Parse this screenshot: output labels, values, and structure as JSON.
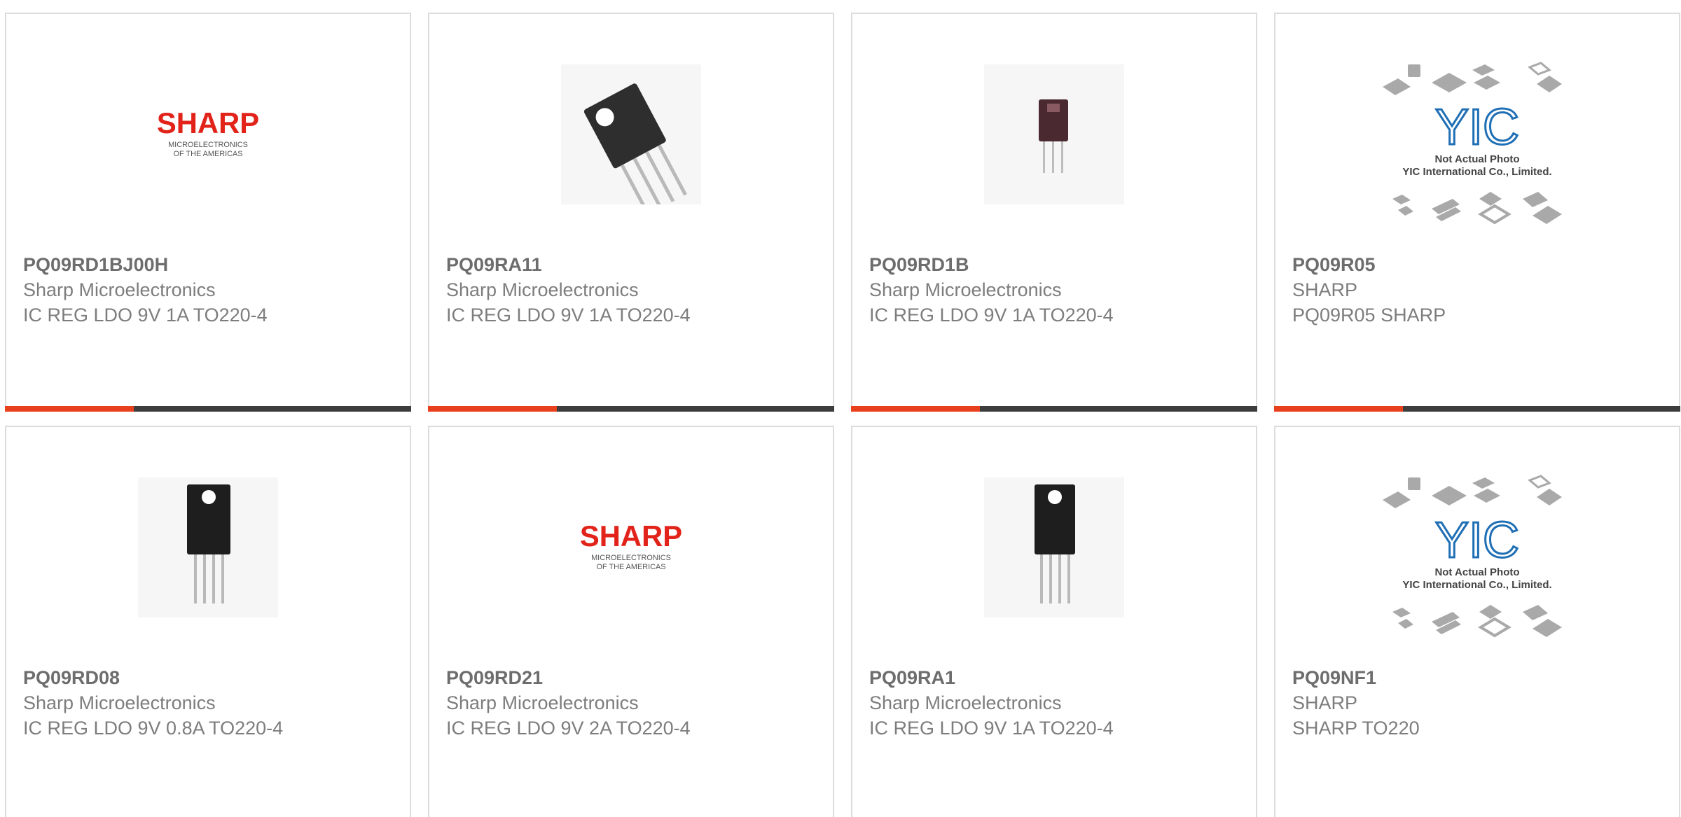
{
  "products": [
    {
      "part": "PQ09RD1BJ00H",
      "manufacturer": "Sharp Microelectronics",
      "description": "IC REG LDO 9V 1A TO220-4",
      "image": "sharp-logo"
    },
    {
      "part": "PQ09RA11",
      "manufacturer": "Sharp Microelectronics",
      "description": "IC REG LDO 9V 1A TO220-4",
      "image": "to220-angled-photo"
    },
    {
      "part": "PQ09RD1B",
      "manufacturer": "Sharp Microelectronics",
      "description": "IC REG LDO 9V 1A TO220-4",
      "image": "to220-small-photo"
    },
    {
      "part": "PQ09R05",
      "manufacturer": "SHARP",
      "description": "PQ09R05 SHARP",
      "image": "yic-placeholder"
    },
    {
      "part": "PQ09RD08",
      "manufacturer": "Sharp Microelectronics",
      "description": "IC REG LDO 9V 0.8A TO220-4",
      "image": "to220-front-photo"
    },
    {
      "part": "PQ09RD21",
      "manufacturer": "Sharp Microelectronics",
      "description": "IC REG LDO 9V 2A TO220-4",
      "image": "sharp-logo"
    },
    {
      "part": "PQ09RA1",
      "manufacturer": "Sharp Microelectronics",
      "description": "IC REG LDO 9V 1A TO220-4",
      "image": "to220-front-photo"
    },
    {
      "part": "PQ09NF1",
      "manufacturer": "SHARP",
      "description": "SHARP TO220",
      "image": "yic-placeholder"
    }
  ],
  "logo": {
    "brand": "SHARP",
    "line1": "MICROELECTRONICS",
    "line2": "OF THE AMERICAS"
  },
  "placeholder": {
    "brand": "YIC",
    "line1": "Not Actual Photo",
    "line2": "YIC International Co., Limited."
  },
  "colors": {
    "accent": "#e8401c",
    "bar": "#3d3d3d",
    "sharp_red": "#e2231a",
    "yic_blue": "#1f6fb5"
  }
}
